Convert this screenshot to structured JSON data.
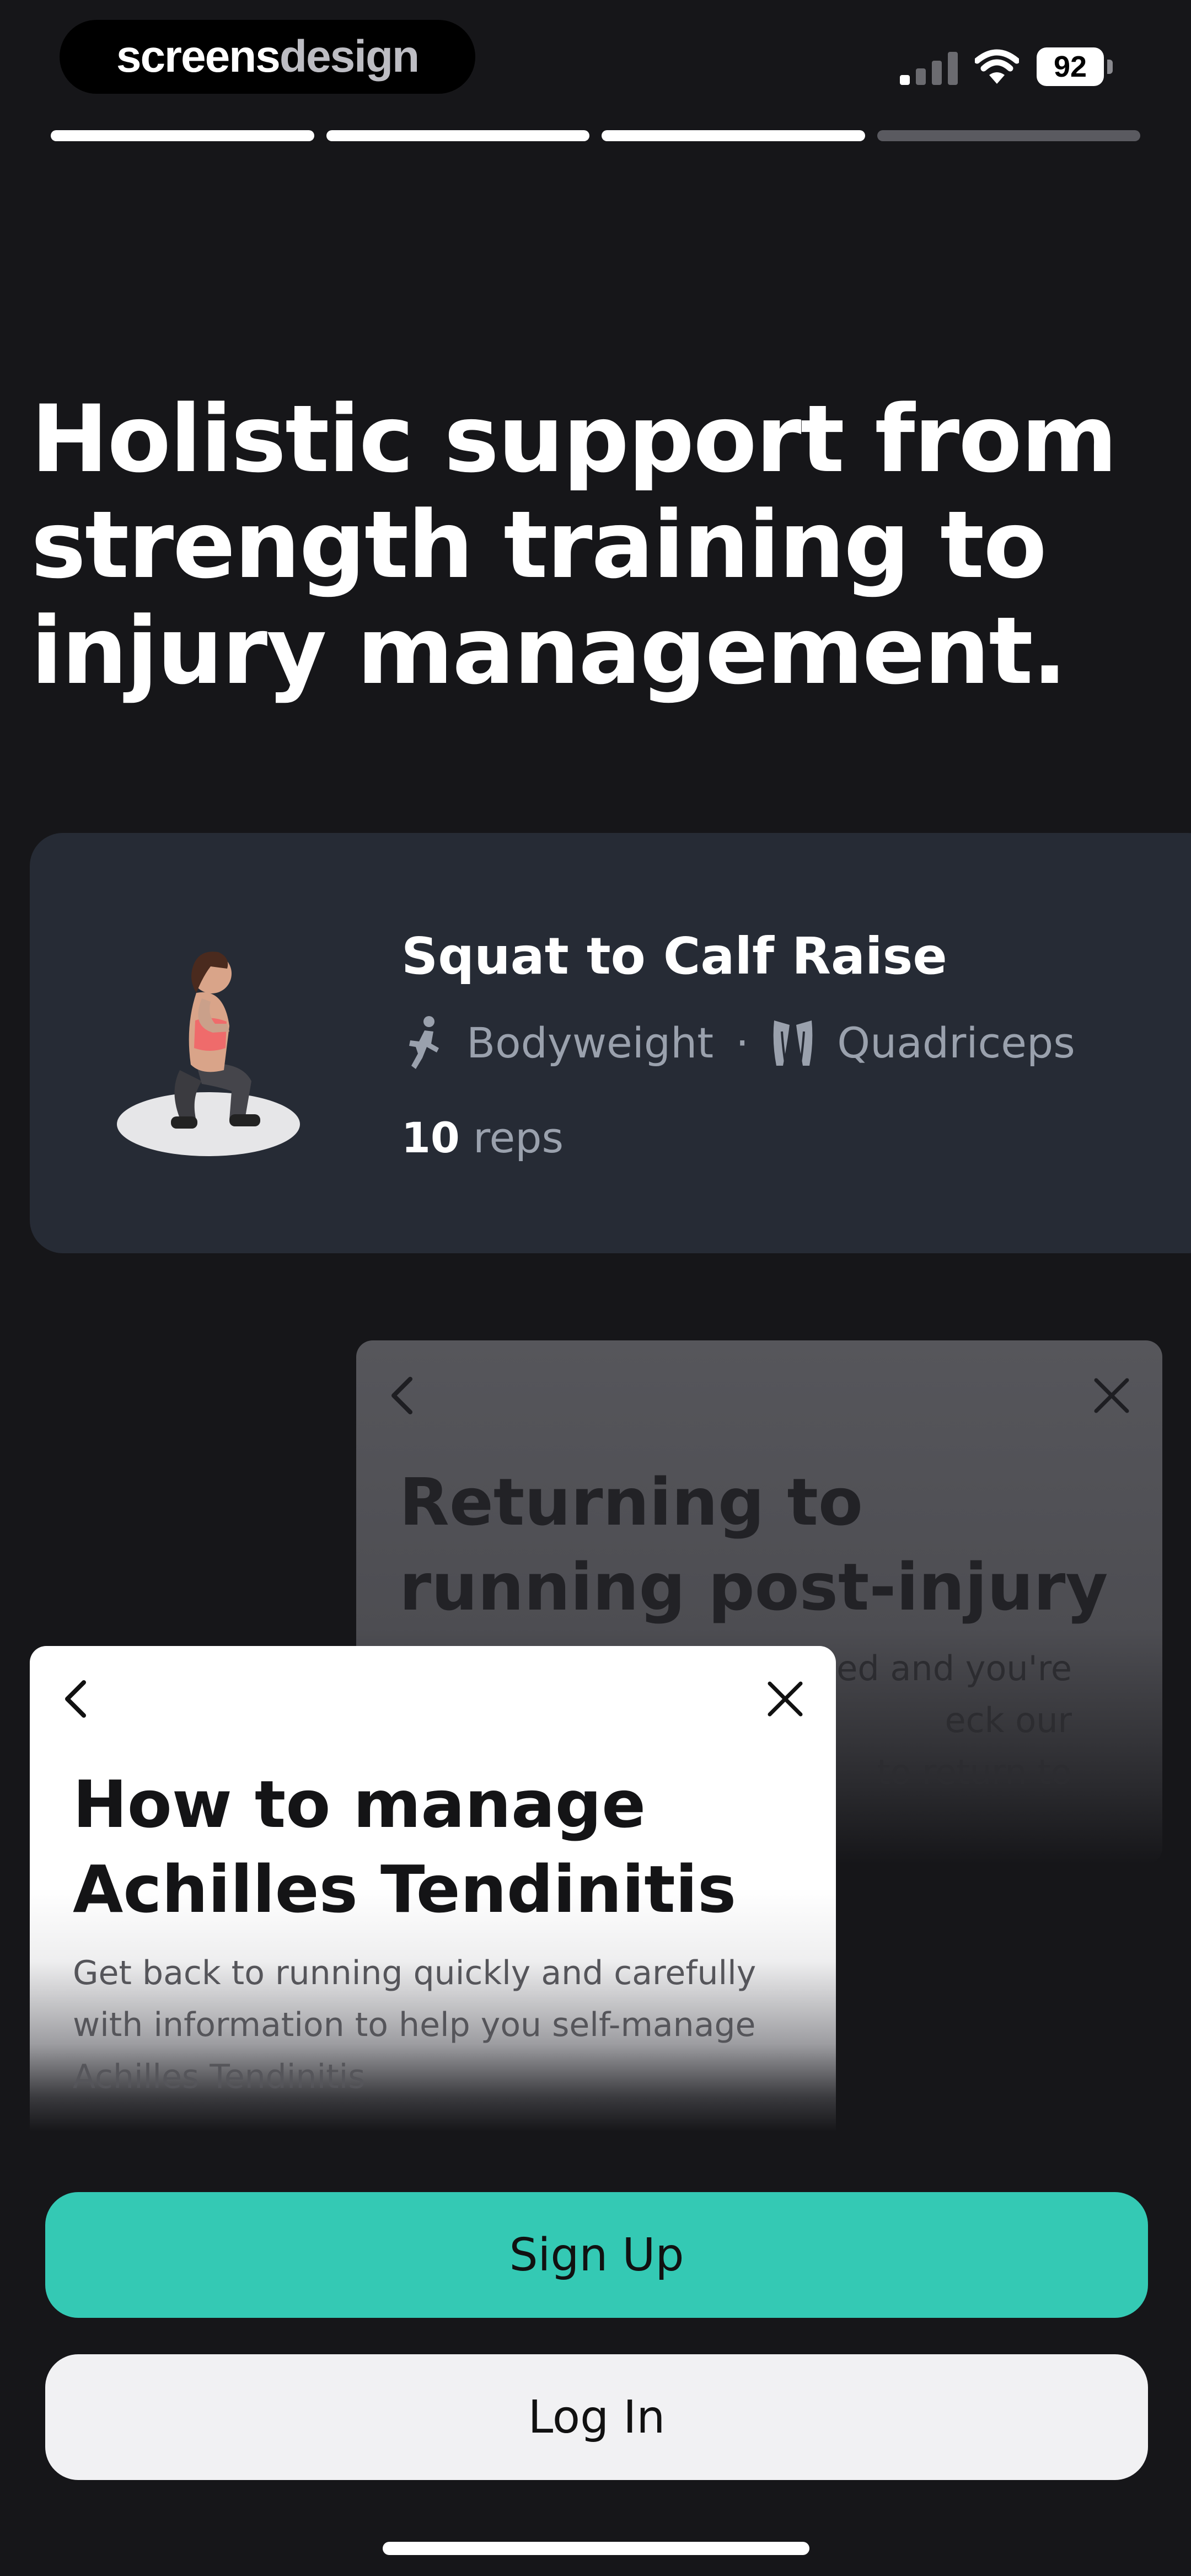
{
  "status_bar": {
    "brand_part1": "screens",
    "brand_part2": "design",
    "battery": "92"
  },
  "onboarding": {
    "progress": {
      "total_steps": 4,
      "current_step": 3
    },
    "headline_lines": [
      "Holistic support from",
      "strength training to",
      "injury management."
    ]
  },
  "exercise_card": {
    "title": "Squat to Calf Raise",
    "equipment": "Bodyweight",
    "separator": "·",
    "muscle": "Quadriceps",
    "reps_count": "10",
    "reps_unit": "reps",
    "icons": [
      "bodyweight-icon",
      "quadriceps-icon"
    ]
  },
  "article_back": {
    "title": "Returning to running post-injury",
    "description_fragment": "ed and you're\neck our\nto return to"
  },
  "article_front": {
    "title": "How to manage Achilles Tendinitis",
    "description": "Get back to running quickly and carefully with information to help you self-manage Achilles Tendinitis"
  },
  "buttons": {
    "sign_up": "Sign Up",
    "log_in": "Log In"
  },
  "colors": {
    "background": "#161619",
    "card": "#262b35",
    "accent": "#34c9b4",
    "secondary_button": "#f1f1f3"
  }
}
